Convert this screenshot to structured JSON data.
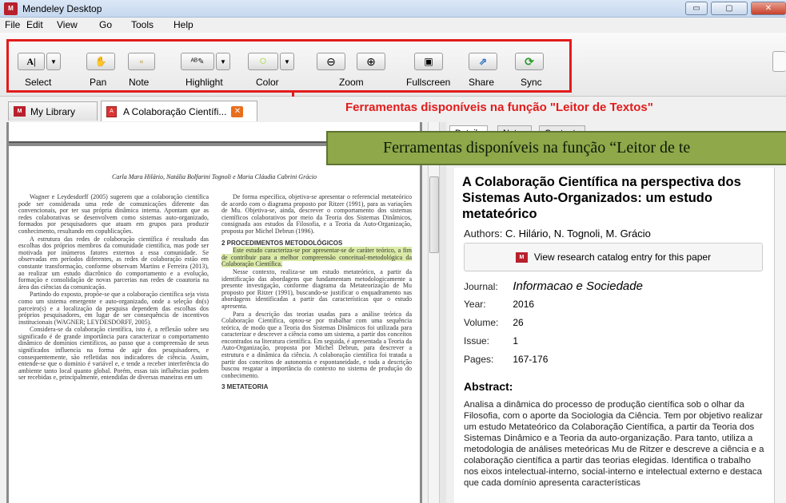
{
  "window": {
    "title": "Mendeley Desktop",
    "app_icon": "mendeley-logo",
    "minimize": "▭",
    "maximize": "▢",
    "close": "✕"
  },
  "menu": [
    "File",
    "Edit",
    "View",
    "Go",
    "Tools",
    "Help"
  ],
  "toolbar": {
    "buttons": [
      {
        "label": "Select",
        "icon": "text-cursor-icon",
        "glyph": "A|"
      },
      {
        "label": "Pan",
        "icon": "hand-icon",
        "glyph": "✋"
      },
      {
        "label": "Note",
        "icon": "note-icon",
        "glyph": "▫"
      },
      {
        "label": "Highlight",
        "icon": "highlighter-icon",
        "glyph": "ᴬᴮ✎"
      },
      {
        "label": "Color",
        "icon": "color-circle-icon",
        "glyph": "○"
      },
      {
        "label": "Zoom",
        "icon": "zoom-icon",
        "glyph_out": "⊖",
        "glyph_in": "⊕"
      },
      {
        "label": "Fullscreen",
        "icon": "fullscreen-icon",
        "glyph": "▣"
      },
      {
        "label": "Share",
        "icon": "share-icon",
        "glyph": "⇗"
      },
      {
        "label": "Sync",
        "icon": "sync-icon",
        "glyph": "⟳"
      }
    ],
    "dropdown_glyph": "▼"
  },
  "annotation_red": "Ferramentas disponíveis na função \"Leitor de Textos\"",
  "annotation_green": "Ferramentas disponíveis na função “Leitor de te",
  "tabs": {
    "library": "My Library",
    "document": "A Colaboração Científi...",
    "close_glyph": "✕"
  },
  "detail_tabs": [
    "Details",
    "Notes",
    "Contents"
  ],
  "pdf": {
    "running_head": "Carla Mara Hilário, Natália Bolfarini Tognoli e Maria Cláudia Cabrini Grácio",
    "left_col": [
      "Wagner e Leydesdorff (2005) sugerem que a colaboração científica pode ser considerada uma rede de comunicações diferente das convencionais, por ter sua própria dinâmica interna. Apontam que as redes colaborativas se desenvolvem como sistemas auto-organizado, formados por pesquisadores que atuam em grupos para produzir conhecimento, resultando em copublicações.",
      "A estrutura das redes de colaboração científica é resultado das escolhas dos próprios membros da comunidade científica, mas pode ser motivada por inúmeros fatores externos a essa comunidade. Se observadas em períodos diferentes, as redes de colaboração estão em constante transformação, conforme observam Martins e Ferreira (2013), ao realizar um estudo diacrônico do comportamento e a evolução, formação e consolidação de novas parcerias nas redes de coautoria na área das ciências da comunicação.",
      "Partindo do exposto, propõe-se que a colaboração científica seja vista como um sistema emergente e auto-organizado, onde a seleção do(s) parceiro(s) e a localização da pesquisa dependem das escolhas dos próprios pesquisadores, em lugar de ser consequência de incentivos institucionais (WAGNER; LEYDESDORFF, 2005).",
      "Considera-se da colaboração científica, isto é, a reflexão sobre seu significado é de grande importância para caracterizar o comportamento dinâmico de domínios científicos, ao passo que a compreensão de seus significados influencia na forma de agir dos pesquisadores, e consequentemente, são refletidas nos indicadores de ciência. Assim, entende-se que o domínio é variável e, e tende a receber interferência do ambiente tanto local quanto global. Porém, essas tais influências podem ser recebidas e, principalmente, entendidas de diversas maneiras em um"
    ],
    "right_col_intro": "De forma específica, objetiva-se apresentar o referencial metateórico de acordo com o diagrama proposto por Ritzer (1991), para as variações de Mu. Objetiva-se, ainda, descrever o comportamento dos sistemas científicos colaborativos por meio da Teoria dos Sistemas Dinâmicos, consignada aos estudos da Filosofia, e a Teoria da Auto-Organização, proposta por Michel Debrun (1996).",
    "section2": "2 PROCEDIMENTOS METODOLÓGICOS",
    "highlighted": "Este estudo caracteriza-se por apresentar-se de caráter teórico, a fim de contribuir para a melhor compreensão conceitual-metodológica da Colaboração Científica.",
    "right_col_body": [
      "Nesse contexto, realiza-se um estudo metateórico, a partir da identificação das abordagens que fundamentam metodologicamente a presente investigação, conforme diagrama da Metateorização de Mu proposto por Ritzer (1991), buscando-se justificar o enquadramento nas abordagens identificadas a partir das características que o estudo apresenta.",
      "Para a descrição das teorias usadas para a análise teórica da Colaboração Científica, optou-se por trabalhar com uma sequência teórica, de modo que a Teoria dos Sistemas Dinâmicos foi utilizada para caracterizar e descrever a ciência como um sistema, a partir dos conceitos encontrados na literatura científica. Em seguida, é apresentada a Teoria da Auto-Organização, proposta por Michel Debrun, para descrever a estrutura e a dinâmica da ciência. A colaboração científica foi tratada a partir dos conceitos de autonomia e espontaneidade, e toda a descrição buscou resgatar a importância do contexto no sistema de produção do conhecimento."
    ],
    "section3": "3 METATEORIA"
  },
  "details": {
    "title": "A Colaboração Científica na perspectiva dos Sistemas Auto-Organizados: um estudo metateórico",
    "authors_label": "Authors:",
    "authors": "C. Hilário, N. Tognoli, M. Grácio",
    "catalog_button": "View research catalog entry for this paper",
    "journal_label": "Journal:",
    "journal": "Informacao e Sociedade",
    "year_label": "Year:",
    "year": "2016",
    "volume_label": "Volume:",
    "volume": "26",
    "issue_label": "Issue:",
    "issue": "1",
    "pages_label": "Pages:",
    "pages": "167-176",
    "abstract_label": "Abstract:",
    "abstract": "Analisa a dinâmica do processo de produção científica sob o olhar da Filosofia, com o aporte da Sociologia da Ciência. Tem por objetivo realizar um estudo Metateórico da Colaboração Científica, a partir da Teoria dos Sistemas Dinâmico e a Teoria da auto-organização. Para tanto, utiliza a metodologia de análises meteóricas Mu de Ritzer e descreve a ciência e a colaboração científica a partir das teorias elegidas. Identifica o trabalho nos eixos intelectual-interno, social-interno e intelectual externo e destaca que cada domínio apresenta características"
  },
  "colors": {
    "red": "#e31b1b",
    "green_box": "#8ea84a",
    "highlight": "#dbeba8",
    "mendeley_red": "#b8202c"
  }
}
